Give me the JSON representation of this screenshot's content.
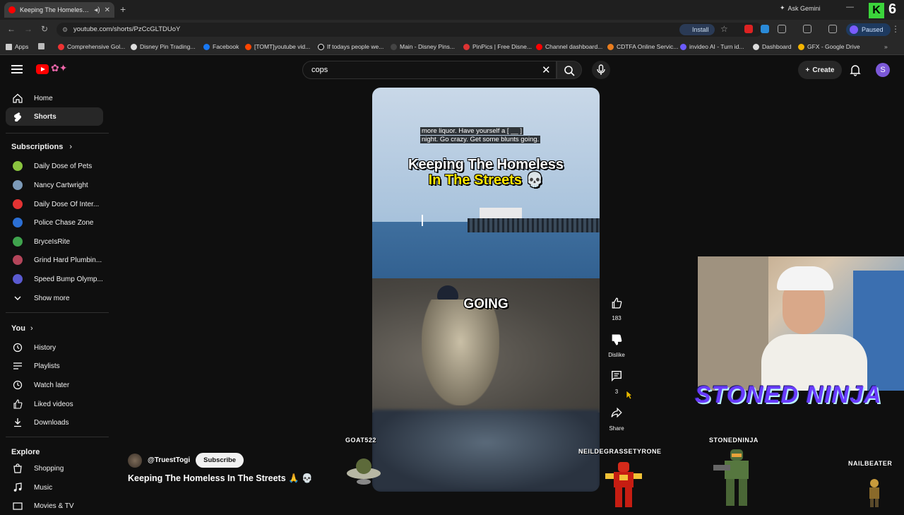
{
  "browser": {
    "tab_title": "Keeping The Homeless In T",
    "gemini": "Ask Gemini",
    "url": "youtube.com/shorts/PzCcGLTDUoY",
    "install": "Install",
    "profile": "Paused",
    "stream_badge": "K",
    "stream_count": "6"
  },
  "bookmarks": [
    "Apps",
    "Comprehensive Gol...",
    "Disney Pin Trading...",
    "Facebook",
    "[TOMT]youtube vid...",
    "If todays people we...",
    "Main - Disney Pins...",
    "PinPics | Free Disne...",
    "Channel dashboard...",
    "CDTFA Online Servic...",
    "invideo AI - Turn id...",
    "Dashboard",
    "GFX - Google Drive"
  ],
  "search": {
    "query": "cops"
  },
  "header": {
    "create": "Create",
    "avatar": "S"
  },
  "sidebar": {
    "main": [
      {
        "label": "Home",
        "icon": "home-icon"
      },
      {
        "label": "Shorts",
        "icon": "shorts-icon"
      }
    ],
    "subscriptions_title": "Subscriptions",
    "subscriptions": [
      {
        "label": "Daily Dose of Pets",
        "color": "#8ac43f"
      },
      {
        "label": "Nancy Cartwright",
        "color": "#7c9ab8"
      },
      {
        "label": "Daily Dose Of Inter...",
        "color": "#e33333"
      },
      {
        "label": "Police Chase Zone",
        "color": "#2b6fd4"
      },
      {
        "label": "BryceIsRite",
        "color": "#3fa34d"
      },
      {
        "label": "Grind Hard Plumbin...",
        "color": "#b4455a"
      },
      {
        "label": "Speed Bump Olymp...",
        "color": "#5a5ad0"
      }
    ],
    "show_more": "Show more",
    "you_title": "You",
    "you": [
      {
        "label": "History",
        "icon": "history-icon"
      },
      {
        "label": "Playlists",
        "icon": "playlists-icon"
      },
      {
        "label": "Watch later",
        "icon": "watch-later-icon"
      },
      {
        "label": "Liked videos",
        "icon": "liked-icon"
      },
      {
        "label": "Downloads",
        "icon": "download-icon"
      }
    ],
    "explore_title": "Explore",
    "explore": [
      {
        "label": "Shopping",
        "icon": "shopping-icon"
      },
      {
        "label": "Music",
        "icon": "music-icon"
      },
      {
        "label": "Movies & TV",
        "icon": "movies-icon"
      }
    ]
  },
  "video": {
    "caption_line1": "more liquor. Have yourself a [ __ ]",
    "caption_line2": "night. Go crazy. Get some blunts going.",
    "title_line1": "Keeping The Homeless",
    "title_line2": "In The Streets",
    "skull": "💀",
    "subtitle_word": "GOING"
  },
  "actions": {
    "likes": "183",
    "dislike": "Dislike",
    "comments": "3",
    "share": "Share"
  },
  "channel": {
    "name": "@TruestTogi",
    "subscribe": "Subscribe",
    "title": "Keeping The Homeless In The Streets 🙏 💀"
  },
  "stream_overlay": {
    "banner": "STONED NINJA",
    "names": [
      "GOAT522",
      "NEILDEGRASSETYRONE",
      "STONEDNINJA",
      "NAILBEATER"
    ]
  }
}
